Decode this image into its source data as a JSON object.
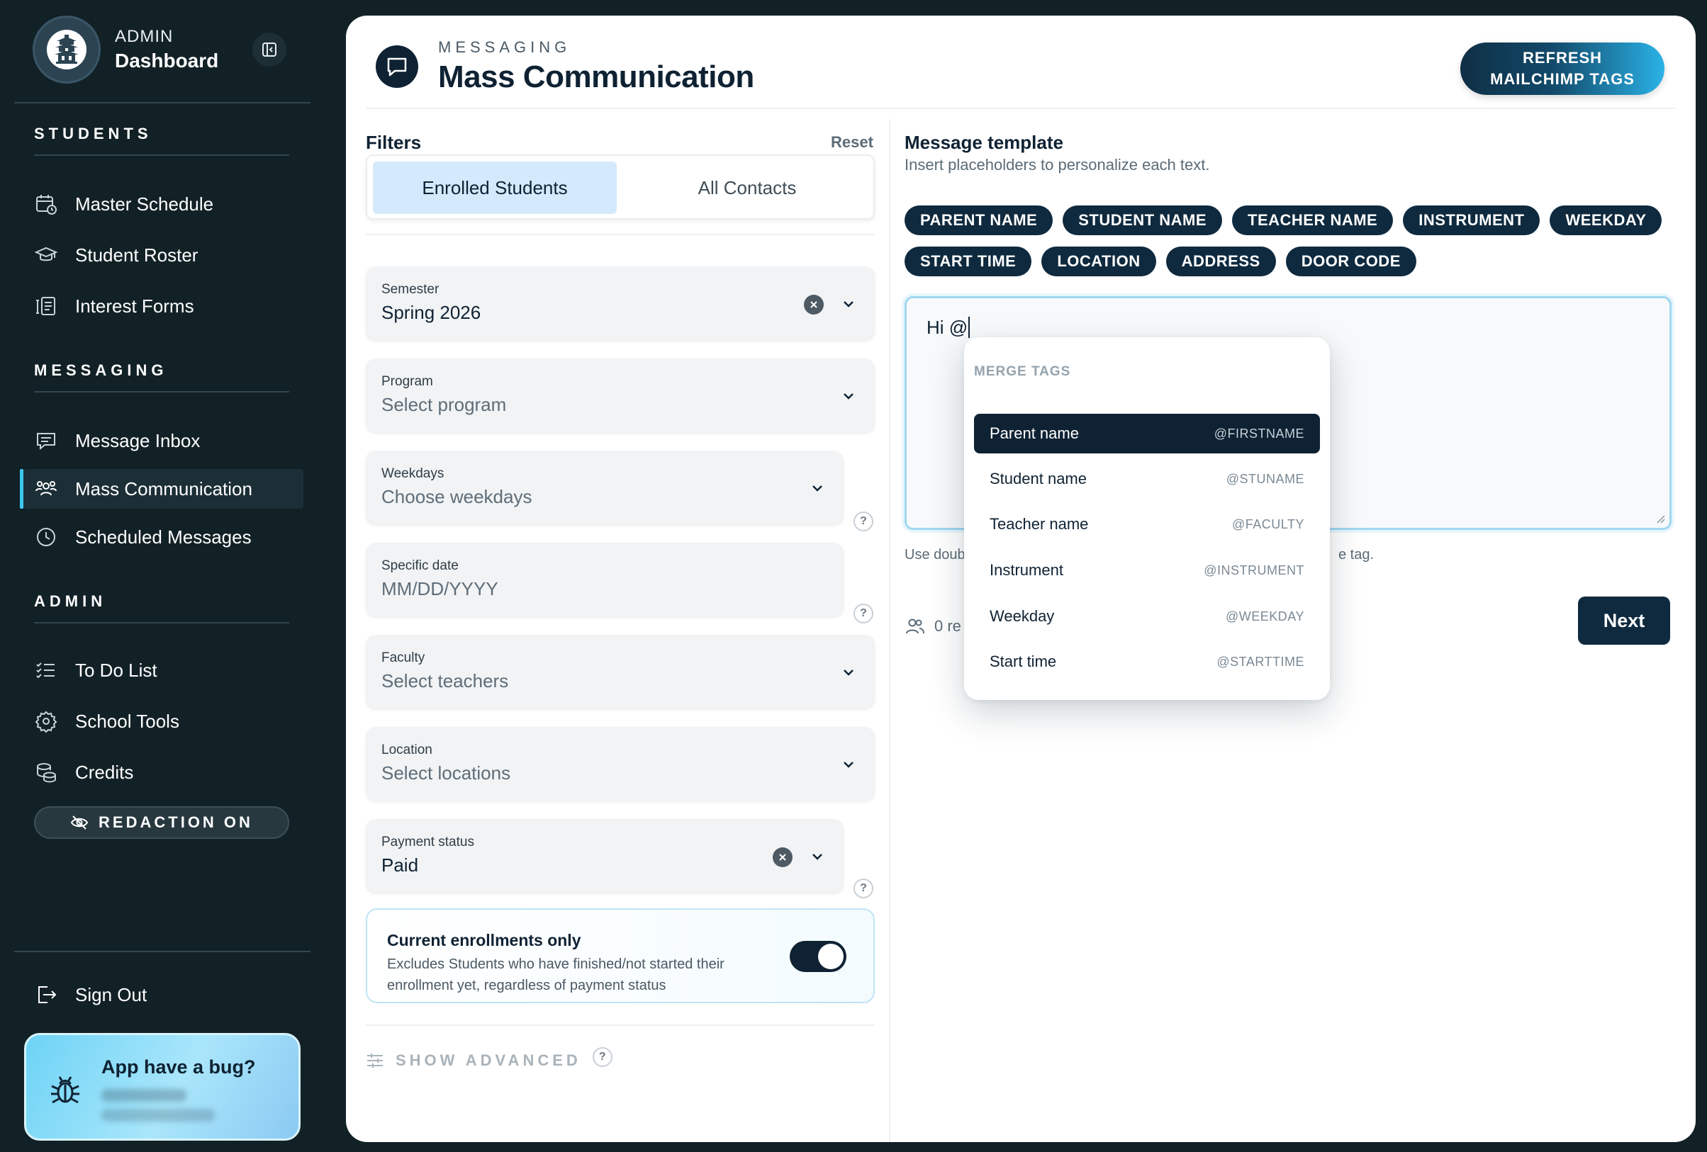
{
  "brand": {
    "subtitle": "ADMIN",
    "title": "Dashboard"
  },
  "sidebar": {
    "sections": [
      {
        "title": "STUDENTS",
        "items": [
          {
            "label": "Master Schedule",
            "icon": "calendar-clock-icon"
          },
          {
            "label": "Student Roster",
            "icon": "graduation-cap-icon"
          },
          {
            "label": "Interest Forms",
            "icon": "form-icon"
          }
        ]
      },
      {
        "title": "MESSAGING",
        "items": [
          {
            "label": "Message Inbox",
            "icon": "message-icon"
          },
          {
            "label": "Mass Communication",
            "icon": "users-icon",
            "active": true
          },
          {
            "label": "Scheduled Messages",
            "icon": "clock-icon"
          }
        ]
      },
      {
        "title": "ADMIN",
        "items": [
          {
            "label": "To Do List",
            "icon": "checklist-icon"
          },
          {
            "label": "School Tools",
            "icon": "gear-icon"
          },
          {
            "label": "Credits",
            "icon": "coins-icon"
          }
        ]
      }
    ],
    "redaction_label": "REDACTION ON",
    "sign_out": "Sign Out",
    "bug_card": {
      "title": "App have a bug?"
    }
  },
  "header": {
    "kicker": "MESSAGING",
    "title": "Mass Communication",
    "refresh_button": "REFRESH MAILCHIMP TAGS"
  },
  "filters": {
    "title": "Filters",
    "reset": "Reset",
    "segments": [
      "Enrolled Students",
      "All Contacts"
    ],
    "selected_segment": "Enrolled Students",
    "fields": [
      {
        "label": "Semester",
        "value": "Spring 2026",
        "placeholder": false
      },
      {
        "label": "Program",
        "value": "Select program",
        "placeholder": true
      },
      {
        "label": "Weekdays",
        "value": "Choose weekdays",
        "placeholder": true
      },
      {
        "label": "Specific date",
        "value": "MM/DD/YYYY",
        "placeholder": true
      },
      {
        "label": "Faculty",
        "value": "Select teachers",
        "placeholder": true
      },
      {
        "label": "Location",
        "value": "Select locations",
        "placeholder": true
      },
      {
        "label": "Payment status",
        "value": "Paid",
        "placeholder": false
      }
    ],
    "current_enrollments": {
      "title": "Current enrollments only",
      "description": "Excludes Students who have finished/not started their enrollment yet, regardless of payment status",
      "enabled": true
    },
    "show_advanced": "SHOW ADVANCED"
  },
  "template": {
    "title": "Message template",
    "subtitle": "Insert placeholders to personalize each text.",
    "chips": [
      "PARENT NAME",
      "STUDENT NAME",
      "TEACHER NAME",
      "INSTRUMENT",
      "WEEKDAY",
      "START TIME",
      "LOCATION",
      "ADDRESS",
      "DOOR CODE"
    ],
    "message_text": "Hi @",
    "hint_left": "Use doub",
    "hint_right": "e tag.",
    "recipients_partial": "0 re",
    "next_button": "Next"
  },
  "merge_menu": {
    "title": "MERGE TAGS",
    "items": [
      {
        "name": "Parent name",
        "tag": "@FIRSTNAME",
        "selected": true
      },
      {
        "name": "Student name",
        "tag": "@STUNAME"
      },
      {
        "name": "Teacher name",
        "tag": "@FACULTY"
      },
      {
        "name": "Instrument",
        "tag": "@INSTRUMENT"
      },
      {
        "name": "Weekday",
        "tag": "@WEEKDAY"
      },
      {
        "name": "Start time",
        "tag": "@STARTTIME"
      }
    ]
  },
  "colors": {
    "sidebar_bg": "#122126",
    "navy": "#0f2233",
    "accent_cyan": "#3cc6ee",
    "segment_active": "#d4eafc"
  }
}
